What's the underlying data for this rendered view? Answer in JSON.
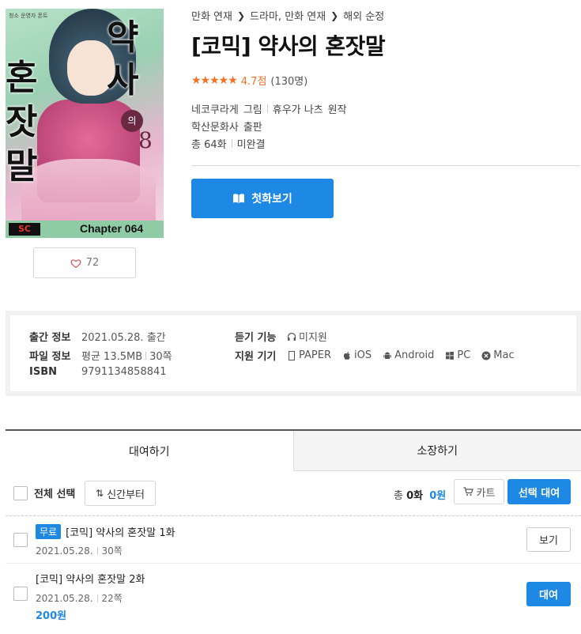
{
  "cover": {
    "tag": "청소 운영자 폰트",
    "title_left": "혼잣말",
    "title_right": "약사",
    "badge": "의",
    "volume": "8",
    "logo": "SC",
    "chapter": "Chapter 064"
  },
  "like": {
    "count": "72",
    "icon": "heart-icon"
  },
  "breadcrumb": [
    "만화 연재",
    "드라마, 만화 연재",
    "해외 순정"
  ],
  "title": "[코믹] 약사의 혼잣말",
  "rating": {
    "stars": "★★★★★",
    "score": "4.7점",
    "count": "(130명)",
    "color": "#f37021"
  },
  "authors": {
    "illustrator": "네코쿠라게",
    "illustrator_role": "그림",
    "writer": "휴우가 나츠",
    "writer_role": "원작"
  },
  "publisher": {
    "name": "학산문화사",
    "role": "출판"
  },
  "episodes_info": {
    "total": "총 64화",
    "status": "미완결"
  },
  "first_episode_button": "첫화보기",
  "pub_info": {
    "release_label": "출간 정보",
    "release_value": "2021.05.28. 출간",
    "file_label": "파일 정보",
    "file_size": "평균 13.5MB",
    "file_pages": "30쪽",
    "isbn_label": "ISBN",
    "isbn_value": "9791134858841",
    "listen_label": "듣기 기능",
    "listen_value": "미지원",
    "device_label": "지원 기기",
    "devices": [
      "PAPER",
      "iOS",
      "Android",
      "PC",
      "Mac"
    ]
  },
  "tabs": [
    "대여하기",
    "소장하기"
  ],
  "toolbar": {
    "select_all": "전체 선택",
    "sort": "신간부터",
    "total_prefix": "총",
    "total_count": "0화",
    "total_price": "0원",
    "cart": "카트",
    "rent_selected": "선택 대여"
  },
  "episodes": [
    {
      "badge": "무료",
      "title": "[코믹] 약사의 혼잣말 1화",
      "date": "2021.05.28.",
      "pages": "30쪽",
      "price": "",
      "action": "보기"
    },
    {
      "badge": "",
      "title": "[코믹] 약사의 혼잣말 2화",
      "date": "2021.05.28.",
      "pages": "22쪽",
      "price": "200원",
      "action": "대여"
    }
  ],
  "colors": {
    "accent": "#1e88e5",
    "rating": "#f37021"
  }
}
